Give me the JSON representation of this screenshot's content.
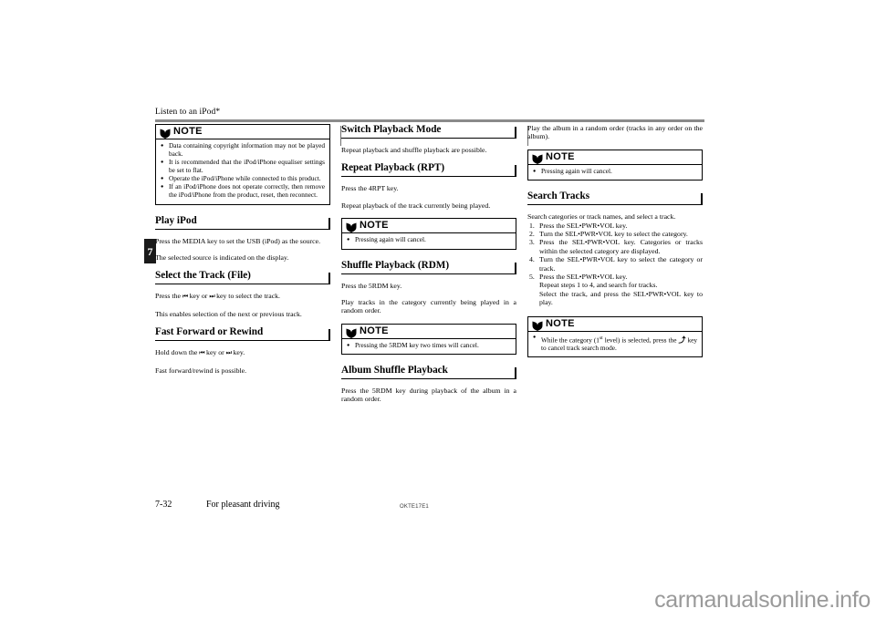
{
  "header": {
    "title": "Listen to an iPod*"
  },
  "chapter_tab": {
    "number": "7"
  },
  "column1": {
    "note1": {
      "label": "NOTE",
      "items": [
        "Data containing copyright information may not be played back.",
        "It is recommended that the iPod/iPhone equaliser settings be set to flat.",
        "Operate the iPod/iPhone while connected to this product.",
        "If an iPod/iPhone does not operate correctly, then remove the iPod/iPhone from the product, reset, then reconnect."
      ]
    },
    "heading_play_ipod": "Play iPod",
    "p_play_1": "Press the MEDIA key to set the USB (iPod) as the source.",
    "p_play_2": "The selected source is indicated on the display.",
    "heading_select_track": "Select the Track (File)",
    "p_select_1_pre": "Press the ",
    "p_select_1_mid": " key or ",
    "p_select_1_post": " key to select the track.",
    "p_select_2": "This enables selection of the next or previous track.",
    "heading_fast_forward": "Fast Forward or Rewind",
    "p_ff_1_pre": "Hold down the ",
    "p_ff_1_mid": " key or ",
    "p_ff_1_post": " key.",
    "p_ff_2": "Fast forward/rewind is possible."
  },
  "column2": {
    "heading_switch_mode": "Switch Playback Mode",
    "p_switch_1": "Repeat playback and shuffle playback are possible.",
    "heading_repeat": "Repeat Playback (RPT)",
    "p_repeat_1": "Press the 4RPT key.",
    "p_repeat_2": "Repeat playback of the track currently being played.",
    "note_repeat": {
      "label": "NOTE",
      "items": [
        "Pressing again will cancel."
      ]
    },
    "heading_shuffle": "Shuffle Playback (RDM)",
    "p_shuffle_1": "Press the 5RDM key.",
    "p_shuffle_2": "Play tracks in the category currently being played in a random order.",
    "note_shuffle": {
      "label": "NOTE",
      "items": [
        "Pressing the 5RDM key two times will cancel."
      ]
    },
    "heading_album_shuffle": "Album Shuffle Playback",
    "p_album_1": "Press the 5RDM key during playback of the album in a random order."
  },
  "column3": {
    "p_album_2": "Play the album in a random order (tracks in any order on the album).",
    "note_album": {
      "label": "NOTE",
      "items": [
        "Pressing again will cancel."
      ]
    },
    "heading_search_tracks": "Search Tracks",
    "p_search_1": "Search categories or track names, and select a track.",
    "steps": [
      "Press the SEL•PWR•VOL key.",
      "Turn the SEL•PWR•VOL key to select the category.",
      "Press the SEL•PWR•VOL key. Categories or tracks within the selected category are displayed.",
      "Turn the SEL•PWR•VOL key to select the category or track.",
      "Press the SEL•PWR•VOL key."
    ],
    "step5_extra_1": "Repeat steps 1 to 4, and search for tracks.",
    "step5_extra_2": "Select the track, and press the SEL•PWR•VOL key to play.",
    "note_search": {
      "label": "NOTE",
      "item_pre": "While the category (1",
      "item_ord": "st",
      "item_mid": " level) is selected, press the ",
      "item_post": " key to cancel track search mode."
    }
  },
  "footer": {
    "page_number": "7-32",
    "section_name": "For pleasant driving",
    "doc_code": "OKTE17E1"
  },
  "watermark": {
    "text": "carmanualsonline.info"
  },
  "icons": {
    "note_icon": "note-book-icon",
    "prev_track": "previous-track-icon",
    "next_track": "next-track-icon",
    "back_key": "back-arrow-icon"
  },
  "colors": {
    "rule": "#8a8a8a",
    "text": "#000000",
    "watermark": "#9a9a9a",
    "tab_bg": "#1a1a1a"
  }
}
